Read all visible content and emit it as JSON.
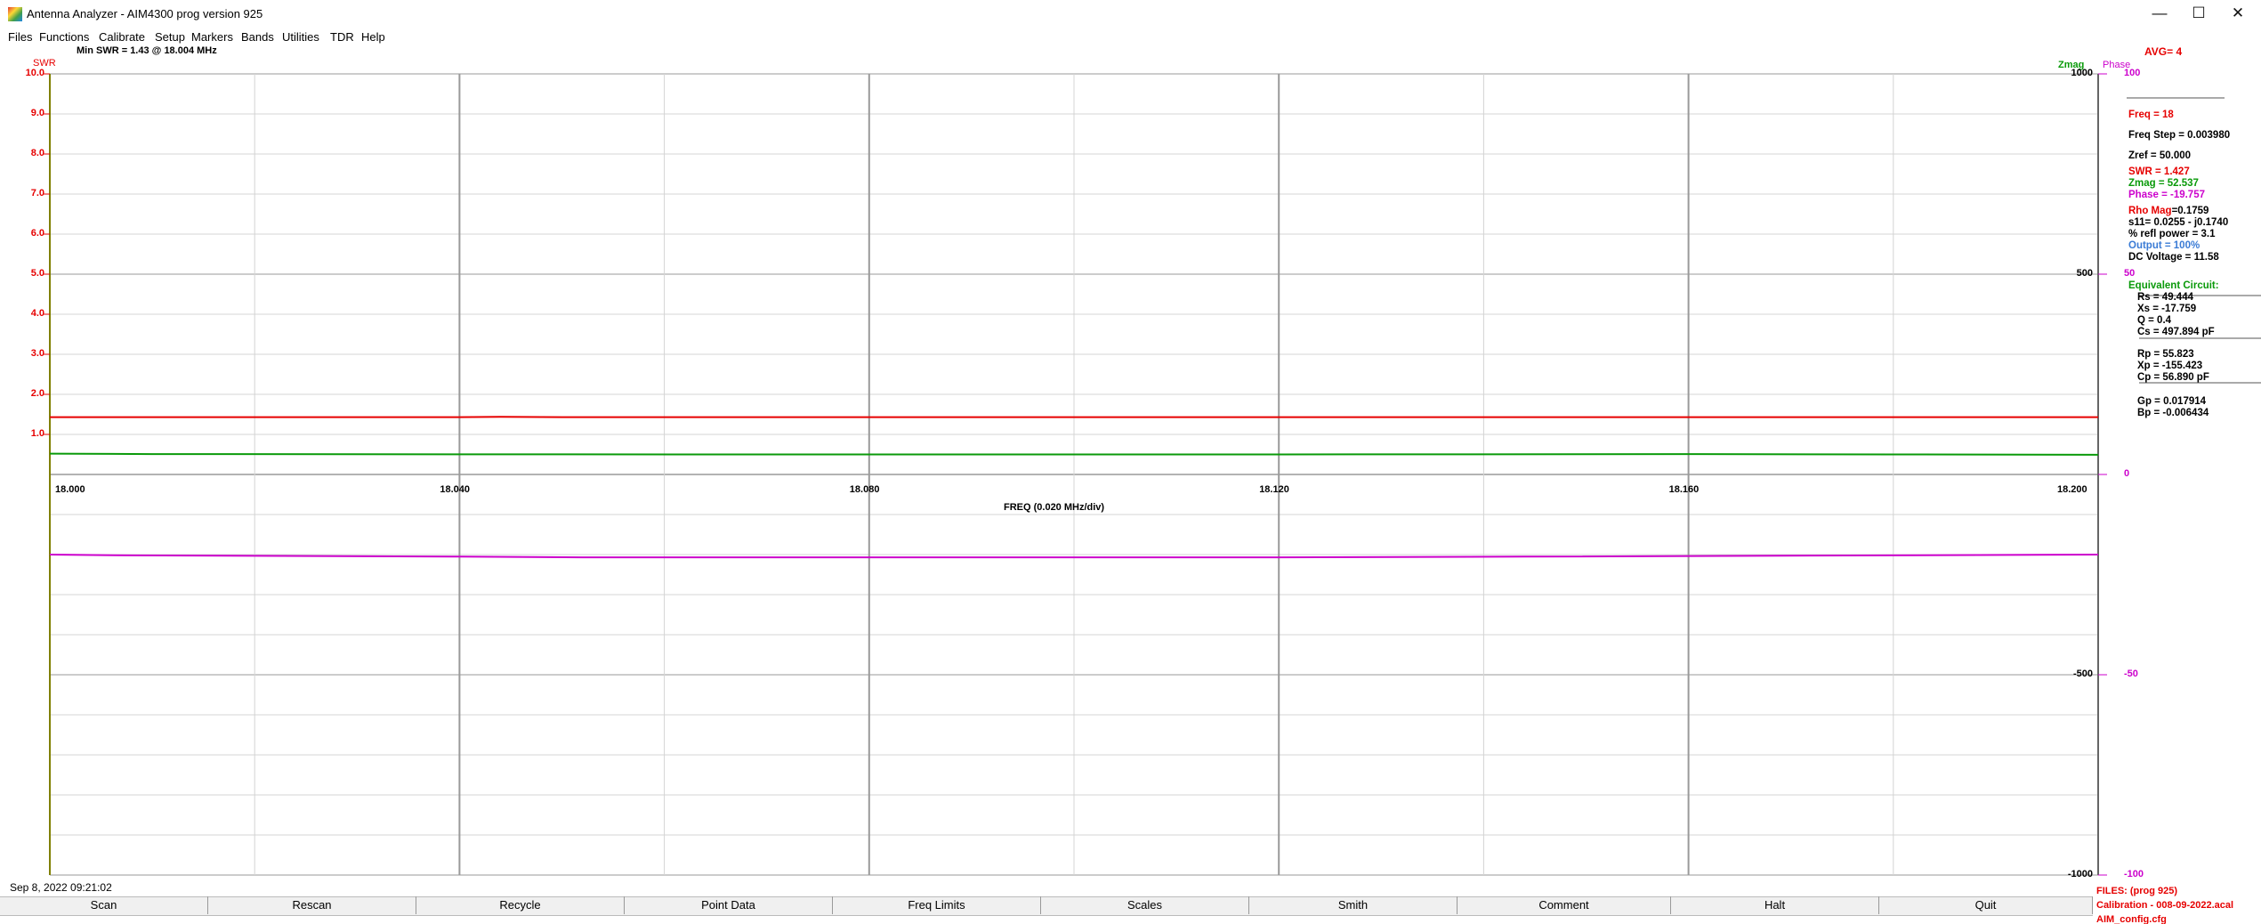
{
  "window": {
    "title": "Antenna Analyzer -  AIM4300    prog version 925",
    "minimize_glyph": "—",
    "maximize_glyph": "☐",
    "close_glyph": "✕"
  },
  "menu": [
    "Files",
    "Functions",
    "Calibrate",
    "Setup",
    "Markers",
    "Bands",
    "Utilities",
    "TDR",
    "Help"
  ],
  "header": {
    "min_swr_text": "Min SWR =    1.43 @   18.004  MHz",
    "avg_text": "AVG=  4"
  },
  "legend": {
    "swr": "SWR",
    "zmag": "Zmag",
    "phase": "Phase"
  },
  "chart_data": {
    "type": "line",
    "xlabel": "FREQ (0.020 MHz/div)",
    "x_ticks": [
      "18.000",
      "18.040",
      "18.080",
      "18.120",
      "18.160",
      "18.200"
    ],
    "xlim": [
      18.0,
      18.2
    ],
    "swr_axis": {
      "label": "SWR",
      "ticks": [
        "10.0",
        "9.0",
        "8.0",
        "7.0",
        "6.0",
        "5.0",
        "4.0",
        "3.0",
        "2.0",
        "1.0"
      ],
      "ylim": [
        0,
        10
      ]
    },
    "zmag_axis": {
      "label": "Zmag",
      "ticks": [
        "1000",
        "500",
        "-500",
        "-1000"
      ],
      "ylim": [
        -1000,
        1000
      ]
    },
    "phase_axis": {
      "label": "Phase",
      "ticks": [
        "100",
        "50",
        "0",
        "-50",
        "-100"
      ],
      "ylim": [
        -100,
        100
      ]
    },
    "series": [
      {
        "name": "SWR",
        "color": "#e60000",
        "axis": "swr",
        "x": [
          18.0,
          18.04,
          18.044,
          18.05,
          18.08,
          18.12,
          18.16,
          18.2
        ],
        "values": [
          1.43,
          1.43,
          1.44,
          1.43,
          1.43,
          1.43,
          1.43,
          1.43
        ]
      },
      {
        "name": "Zmag",
        "color": "#0a9a0a",
        "axis": "zmag",
        "x": [
          18.0,
          18.01,
          18.064,
          18.12,
          18.16,
          18.18,
          18.2
        ],
        "values": [
          52,
          51,
          50,
          50,
          51,
          50,
          49
        ]
      },
      {
        "name": "Phase",
        "color": "#cc00cc",
        "axis": "phase",
        "x": [
          18.0,
          18.008,
          18.04,
          18.052,
          18.08,
          18.12,
          18.144,
          18.2
        ],
        "values": [
          -20,
          -20.2,
          -20.5,
          -20.7,
          -20.7,
          -20.7,
          -20.5,
          -20.0
        ]
      }
    ],
    "grid": true
  },
  "readout": {
    "freq": "Freq = 18",
    "freq_step": "Freq Step = 0.003980",
    "zref": "Zref =    50.000",
    "swr": "SWR =     1.427",
    "zmag": "Zmag =    52.537",
    "phase": "Phase =   -19.757",
    "rho_label": "Rho Mag",
    "rho_value": "=0.1759",
    "s11": "s11= 0.0255 - j0.1740",
    "refl_power": "% refl power =   3.1",
    "output": "Output =  100%",
    "dc_voltage": "DC Voltage =   11.58",
    "eq_title": "Equivalent Circuit:",
    "rs": "Rs =   49.444",
    "xs": "Xs =  -17.759",
    "q": "Q =   0.4",
    "cs": "Cs =  497.894  pF",
    "rp": "Rp =   55.823",
    "xp": "Xp = -155.423",
    "cp": "Cp =   56.890  pF",
    "gp": "Gp =   0.017914",
    "bp": "Bp = -0.006434"
  },
  "status": {
    "datetime": "Sep 8, 2022   09:21:02"
  },
  "buttons": [
    "Scan",
    "Rescan",
    "Recycle",
    "Point Data",
    "Freq Limits",
    "Scales",
    "Smith",
    "Comment",
    "Halt",
    "Quit"
  ],
  "files": {
    "line1": "FILES:  (prog 925)",
    "line2": "Calibration - 008-09-2022.acal",
    "line3": "AIM_config.cfg"
  },
  "colors": {
    "swr": "#e60000",
    "zmag": "#0a9a0a",
    "phase": "#cc00cc",
    "output": "#3a7bd5"
  }
}
